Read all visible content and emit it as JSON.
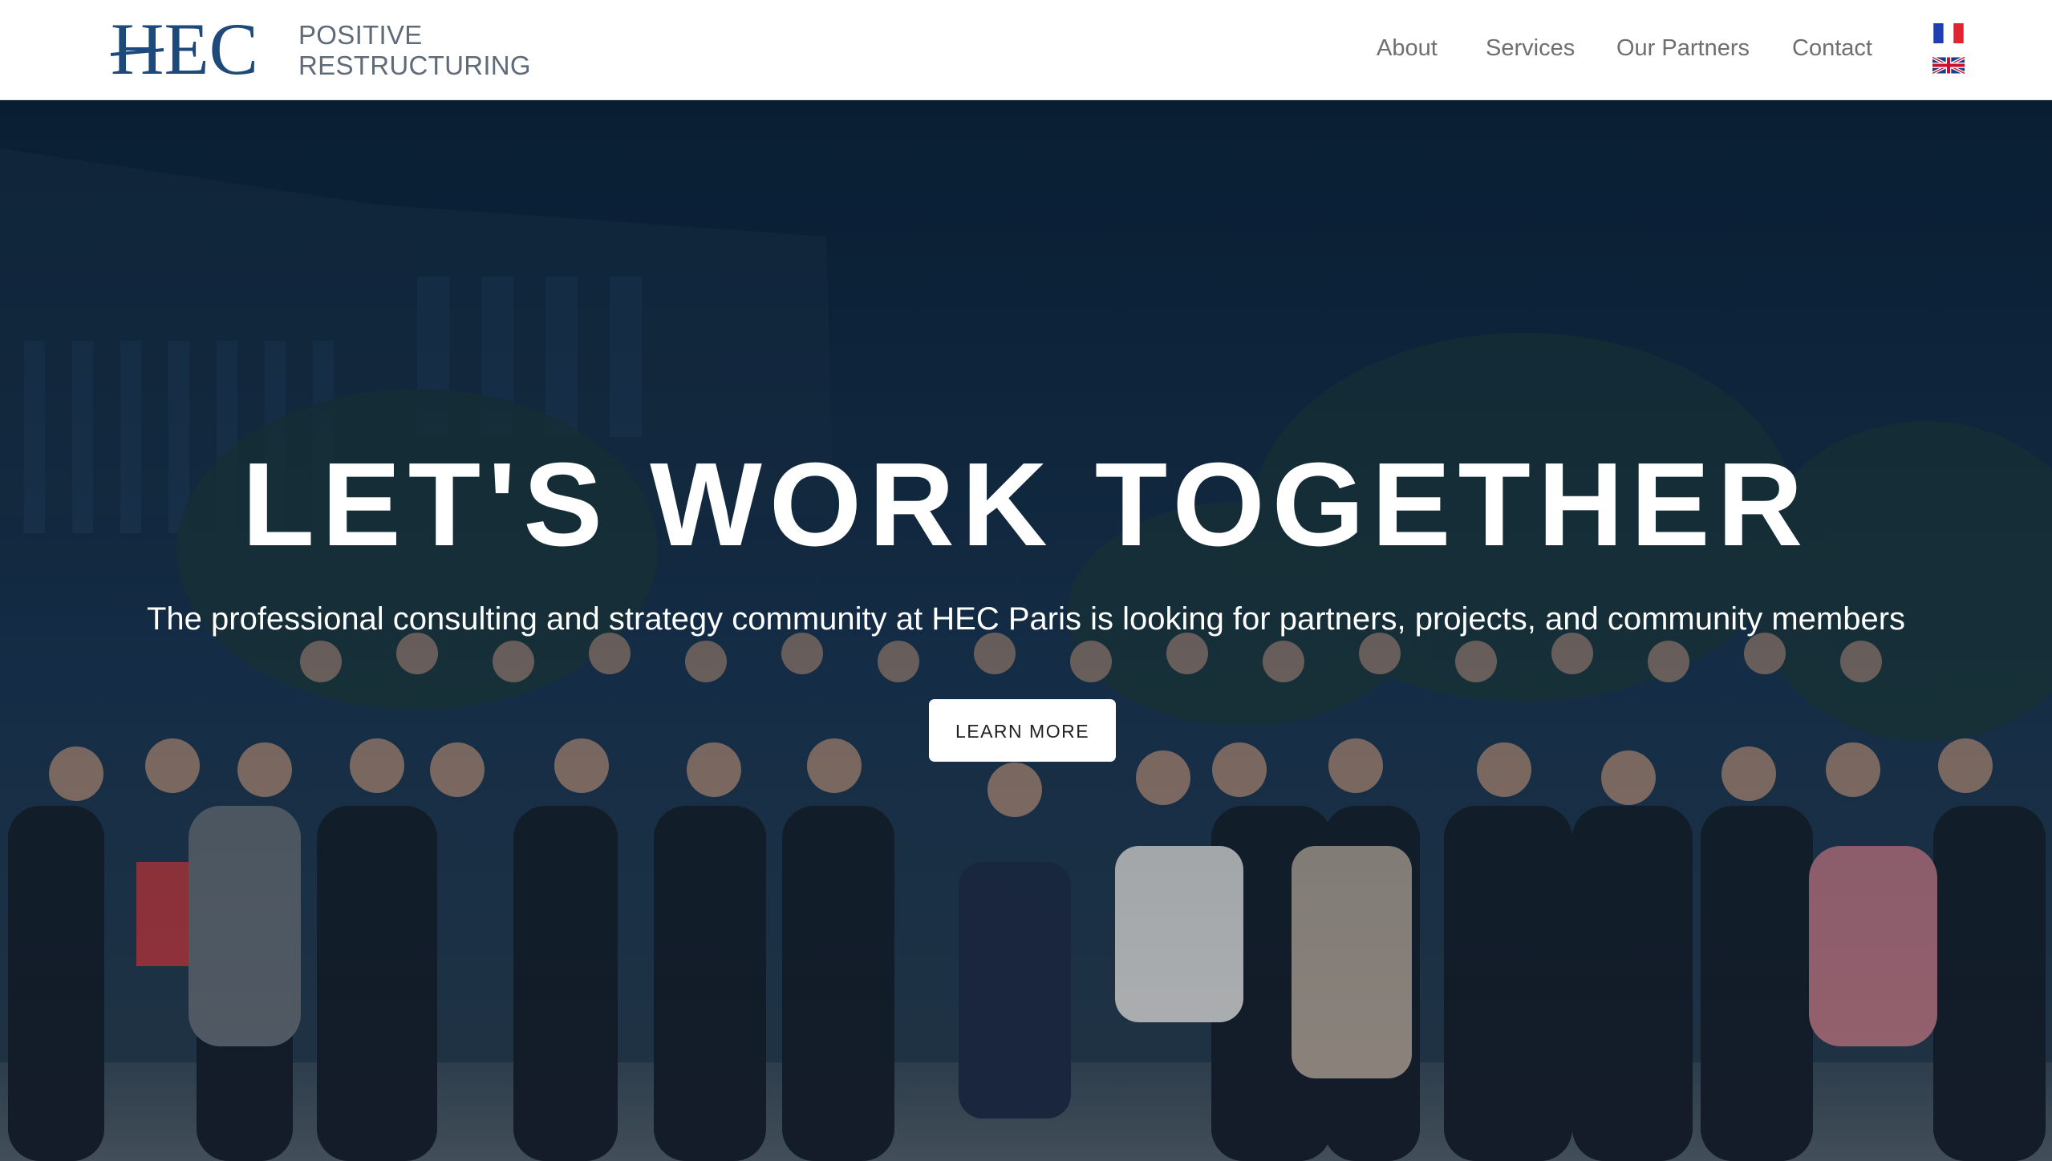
{
  "brand": {
    "logo_text": "HEC",
    "name_line1": "POSITIVE",
    "name_line2": "RESTRUCTURING",
    "logo_color": "#1d4a7a"
  },
  "nav": {
    "items": [
      {
        "label": "About"
      },
      {
        "label": "Services"
      },
      {
        "label": "Our Partners"
      },
      {
        "label": "Contact"
      }
    ],
    "languages": [
      {
        "icon": "flag-france-icon"
      },
      {
        "icon": "flag-uk-icon"
      }
    ]
  },
  "hero": {
    "title": "LET'S WORK TOGETHER",
    "subtitle": "The professional consulting and strategy community at HEC Paris is looking for partners, projects, and community members",
    "button_label": "LEARN MORE",
    "background_icon": "group-photo"
  }
}
